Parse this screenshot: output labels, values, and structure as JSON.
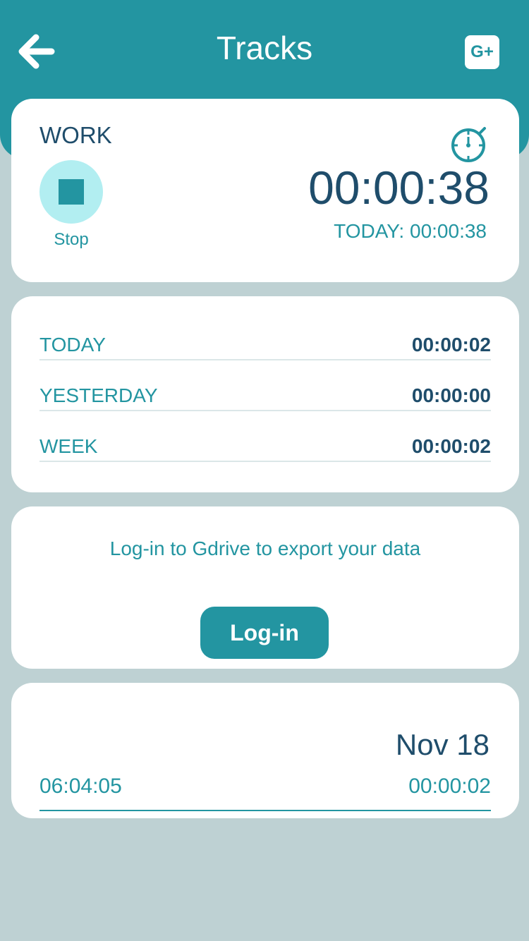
{
  "header": {
    "title": "Tracks",
    "back_icon": "arrow-left-icon",
    "share_icon": "google-plus-icon",
    "share_label": "G+"
  },
  "timer": {
    "task_name": "WORK",
    "stop_label": "Stop",
    "elapsed": "00:00:38",
    "today_total": "TODAY: 00:00:38",
    "icon": "stopwatch-icon"
  },
  "stats": {
    "rows": [
      {
        "label": "TODAY",
        "value": "00:00:02"
      },
      {
        "label": "YESTERDAY",
        "value": "00:00:00"
      },
      {
        "label": "WEEK",
        "value": "00:00:02"
      }
    ]
  },
  "login": {
    "message": "Log-in to Gdrive to export your data",
    "button_label": "Log-in"
  },
  "log": {
    "date": "Nov 18",
    "entries": [
      {
        "start": "06:04:05",
        "duration": "00:00:02"
      }
    ]
  },
  "colors": {
    "primary": "#2395a1",
    "dark_text": "#1f4d6b",
    "background": "#bed1d3",
    "stop_circle": "#b2eef1"
  }
}
